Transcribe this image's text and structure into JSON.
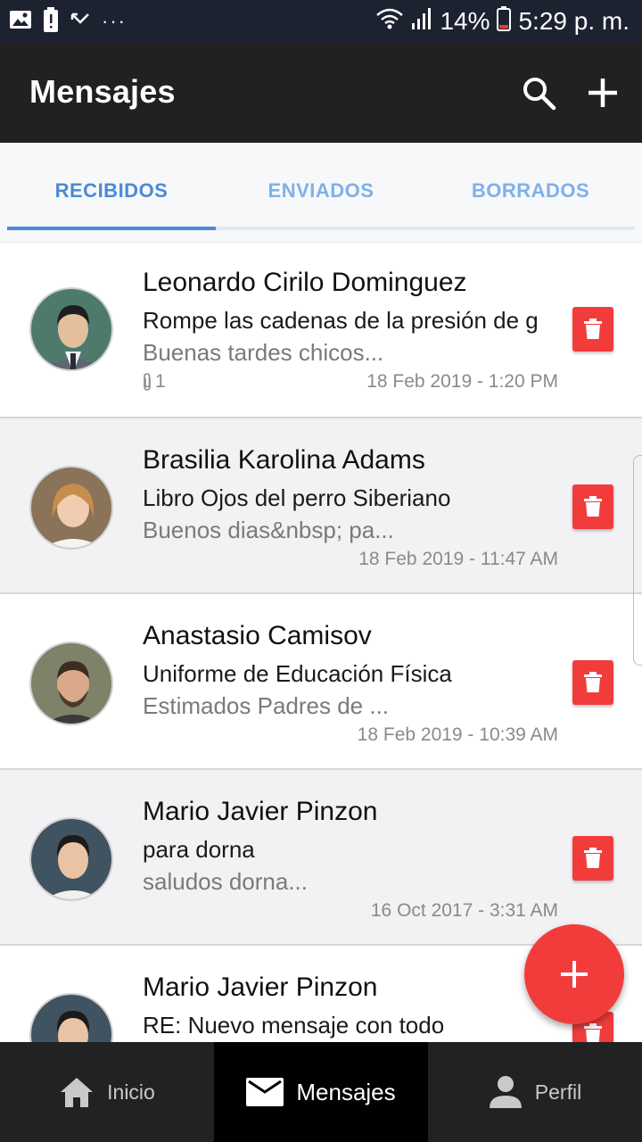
{
  "status_bar": {
    "battery": "14%",
    "time": "5:29 p. m.",
    "more": "···"
  },
  "app_bar": {
    "title": "Mensajes",
    "icons": [
      "search-icon",
      "add-icon"
    ]
  },
  "tabs": [
    {
      "label": "RECIBIDOS",
      "active": true
    },
    {
      "label": "ENVIADOS",
      "active": false
    },
    {
      "label": "BORRADOS",
      "active": false
    }
  ],
  "messages": [
    {
      "sender": "Leonardo Cirilo Dominguez",
      "subject": "Rompe las cadenas de la presión de g",
      "preview": "Buenas tardes chicos...",
      "attachments": "1",
      "date": "18 Feb 2019 - 1:20 PM"
    },
    {
      "sender": "Brasilia Karolina Adams",
      "subject": "Libro Ojos del perro Siberiano",
      "preview": "Buenos dias&nbsp; pa...",
      "date": "18 Feb 2019 - 11:47 AM"
    },
    {
      "sender": "Anastasio Camisov",
      "subject": "Uniforme de Educación Física",
      "preview": "Estimados Padres de ...",
      "date": "18 Feb 2019 - 10:39 AM"
    },
    {
      "sender": "Mario Javier Pinzon",
      "subject": "para dorna",
      "preview": "saludos dorna...",
      "date": "16 Oct 2017 - 3:31 AM"
    },
    {
      "sender": "Mario Javier Pinzon",
      "subject": "RE: Nuevo mensaje con todo",
      "preview": "",
      "date": ""
    }
  ],
  "colors": {
    "accent_red": "#f23c3c",
    "tab_active": "#4b8ad6",
    "app_bar": "#212121"
  },
  "bottom_nav": [
    {
      "label": "Inicio",
      "icon": "home-icon",
      "active": false
    },
    {
      "label": "Mensajes",
      "icon": "mail-icon",
      "active": true
    },
    {
      "label": "Perfil",
      "icon": "person-icon",
      "active": false
    }
  ]
}
